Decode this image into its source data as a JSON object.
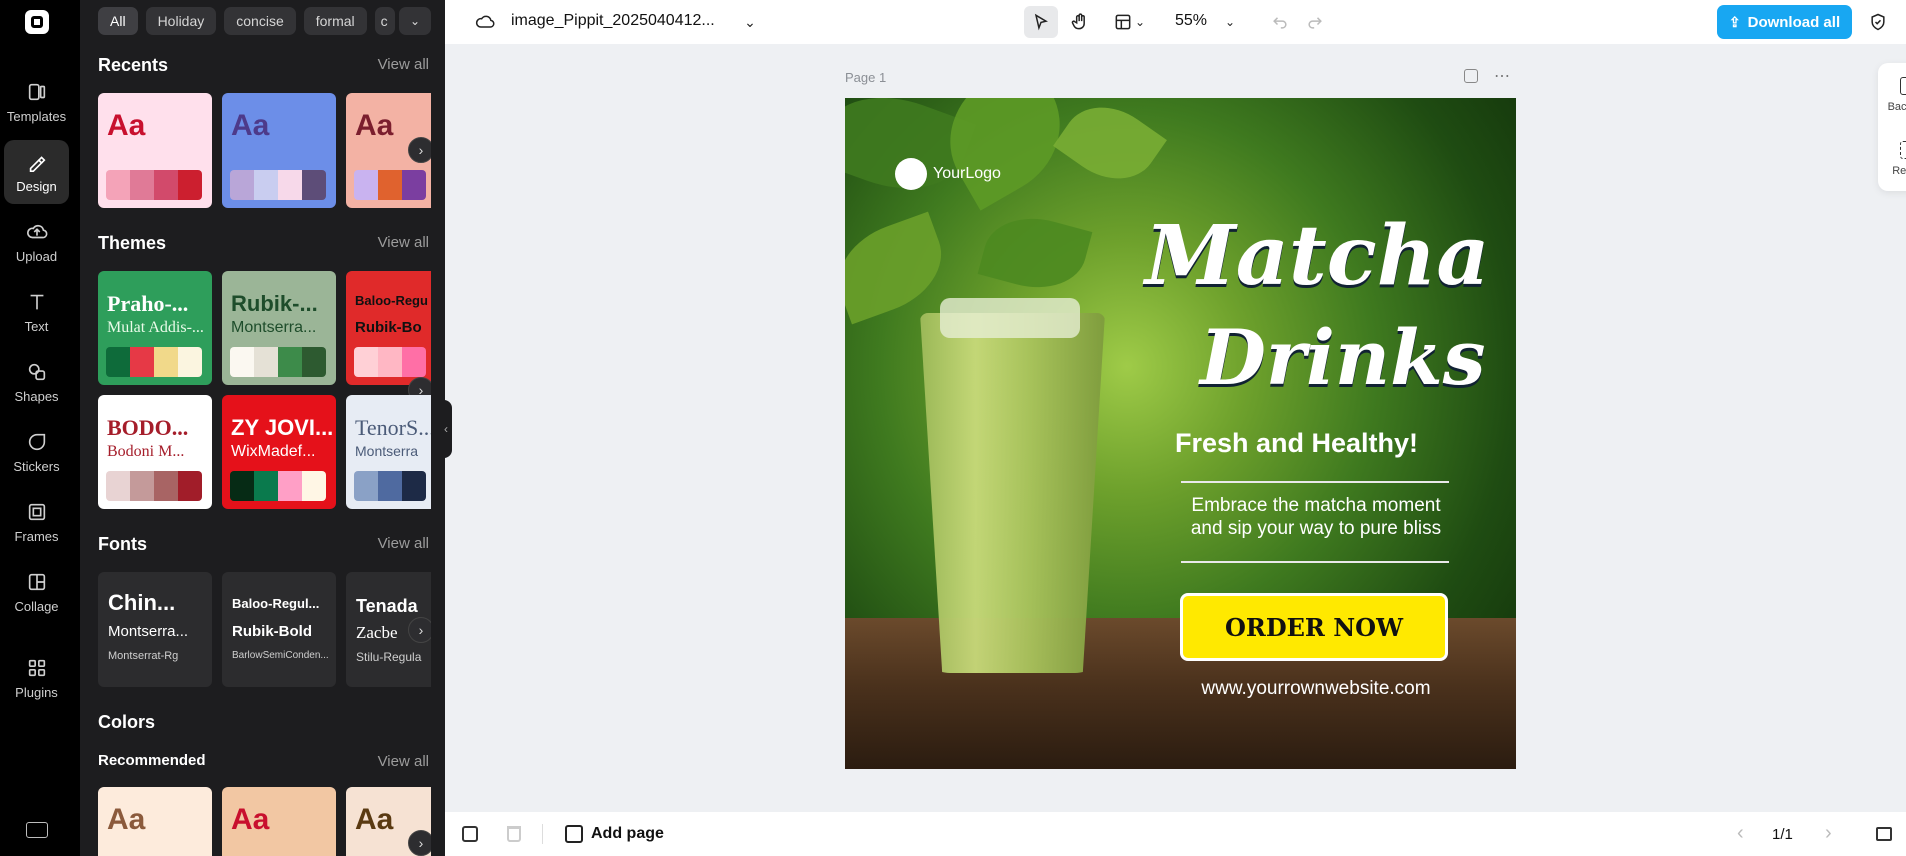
{
  "rail": {
    "items": [
      {
        "label": "Templates",
        "icon": "templates-icon"
      },
      {
        "label": "Design",
        "icon": "design-icon",
        "active": true
      },
      {
        "label": "Upload",
        "icon": "upload-icon"
      },
      {
        "label": "Text",
        "icon": "text-icon"
      },
      {
        "label": "Shapes",
        "icon": "shapes-icon"
      },
      {
        "label": "Stickers",
        "icon": "stickers-icon"
      },
      {
        "label": "Frames",
        "icon": "frames-icon"
      },
      {
        "label": "Collage",
        "icon": "collage-icon"
      },
      {
        "label": "Plugins",
        "icon": "plugins-icon"
      }
    ]
  },
  "panel": {
    "filters": [
      "All",
      "Holiday",
      "concise",
      "formal",
      "c"
    ],
    "recents": {
      "title": "Recents",
      "view_all": "View all",
      "cards": [
        {
          "aa": "Aa",
          "bg": "#ffe0ec",
          "fg": "#c8102e",
          "swatches": [
            "#f4a3b8",
            "#e07a97",
            "#d24a6b",
            "#cc1f2f"
          ]
        },
        {
          "aa": "Aa",
          "bg": "#6c8ee8",
          "fg": "#4d3a8a",
          "swatches": [
            "#b9a6d8",
            "#c9cdf0",
            "#f7d9ea",
            "#5d4d78"
          ]
        },
        {
          "aa": "Aa",
          "bg": "#f3b2a4",
          "fg": "#7b1e2e",
          "swatches": [
            "#c9b3f0",
            "#e0622e",
            "#7b3ea0"
          ]
        }
      ]
    },
    "themes": {
      "title": "Themes",
      "view_all": "View all",
      "row1": [
        {
          "heading": "Praho-...",
          "sub": "Mulat Addis-...",
          "bg": "#2e9e5b",
          "fg": "#ffffff",
          "swatches": [
            "#0e6b3a",
            "#e63946",
            "#f1d98a",
            "#fbf5e0"
          ]
        },
        {
          "heading": "Rubik-...",
          "sub": "Montserra...",
          "bg": "#9bb597",
          "fg": "#1e4d2b",
          "swatches": [
            "#fbf8f1",
            "#e5e1d6",
            "#3d8b4a",
            "#2d5a30"
          ]
        },
        {
          "heading": "Baloo-Regu",
          "sub": "Rubik-Bo",
          "bg": "#e02a2a",
          "fg": "#111111",
          "swatches": [
            "#ffd0d6",
            "#ffb7c4",
            "#ff6fa6"
          ]
        }
      ],
      "row2": [
        {
          "heading": "BODO...",
          "sub": "Bodoni M...",
          "bg": "#ffffff",
          "fg": "#a51d2a",
          "swatches": [
            "#e8d3d3",
            "#c49a9a",
            "#a86464",
            "#a11d29"
          ]
        },
        {
          "heading": "ZY JOVI...",
          "sub": "WixMadef...",
          "bg": "#e5111a",
          "fg": "#ffffff",
          "swatches": [
            "#062b15",
            "#0a7a4d",
            "#ff9fc6",
            "#fff6e5"
          ]
        },
        {
          "heading": "TenorS...",
          "sub": "Montserra",
          "bg": "#e7ecf4",
          "fg": "#4b5b78",
          "swatches": [
            "#8aa1c6",
            "#4f6aa0",
            "#1d2a46"
          ]
        }
      ]
    },
    "fonts": {
      "title": "Fonts",
      "view_all": "View all",
      "cards": [
        {
          "f1": "Chin...",
          "f2": "Montserra...",
          "f3": "Montserrat-Rg"
        },
        {
          "f1": "Baloo-Regul...",
          "f2": "Rubik-Bold",
          "f3": "BarlowSemiConden..."
        },
        {
          "f1": "Tenada",
          "f2": "Zacbe",
          "f3": "Stilu-Regula"
        }
      ]
    },
    "colors": {
      "title": "Colors",
      "recommended": "Recommended",
      "view_all": "View all",
      "cards": [
        {
          "aa": "Aa",
          "bg": "#fdebdc",
          "fg": "#8b5a3c"
        },
        {
          "aa": "Aa",
          "bg": "#f2c7a3",
          "fg": "#c8102e"
        },
        {
          "aa": "Aa",
          "bg": "#f6e2d3",
          "fg": "#5a3a12"
        }
      ]
    }
  },
  "topbar": {
    "file_name": "image_Pippit_2025040412...",
    "zoom": "55%",
    "download_label": "Download all",
    "accent": "#18a7f2"
  },
  "canvas": {
    "page_label": "Page 1",
    "design": {
      "logo": "YourLogo",
      "title_line1": "Matcha",
      "title_line2": "Drinks",
      "tagline": "Fresh and Healthy!",
      "body_line1": "Embrace the matcha moment",
      "body_line2": "and sip your way to pure bliss",
      "cta": "ORDER NOW",
      "website": "www.yourrownwebsite.com",
      "cta_color": "#ffe900"
    }
  },
  "right_tools": [
    {
      "label": "Backgr..."
    },
    {
      "label": "Resize"
    }
  ],
  "bottombar": {
    "add_page": "Add page",
    "page_count": "1/1"
  }
}
